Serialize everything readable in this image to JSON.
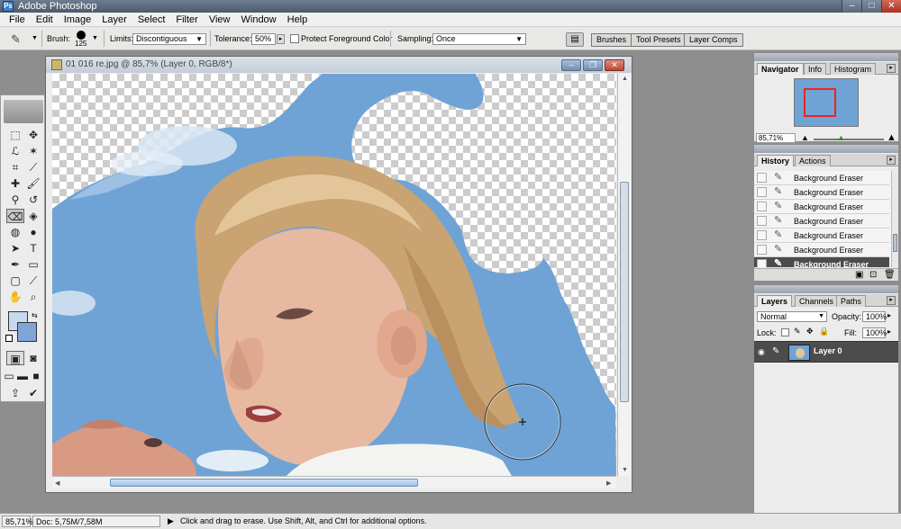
{
  "window": {
    "title": "Adobe Photoshop",
    "app_icon": "Ps"
  },
  "window_buttons": {
    "minimize": "–",
    "maximize": "□",
    "close": "✕"
  },
  "menu": [
    "File",
    "Edit",
    "Image",
    "Layer",
    "Select",
    "Filter",
    "View",
    "Window",
    "Help"
  ],
  "options": {
    "brush_label": "Brush:",
    "brush_size": "125",
    "limits_label": "Limits:",
    "limits_value": "Discontiguous",
    "tolerance_label": "Tolerance:",
    "tolerance_value": "50%",
    "protect_label": "Protect Foreground Color",
    "sampling_label": "Sampling:",
    "sampling_value": "Once",
    "tab_wells": [
      "Brushes",
      "Tool Presets",
      "Layer Comps"
    ]
  },
  "document": {
    "title": "01 016 re.jpg @ 85,7% (Layer 0, RGB/8*)",
    "buttons": {
      "minimize": "–",
      "restore": "❐",
      "close": "✕"
    }
  },
  "status": {
    "zoom": "85,71%",
    "doc": "Doc: 5,75M/7,58M",
    "hint": "Click and drag to erase.  Use Shift, Alt, and Ctrl for additional options."
  },
  "navigator": {
    "tabs": [
      "Navigator",
      "Info",
      "Histogram"
    ],
    "zoom": "85,71%"
  },
  "history": {
    "tabs": [
      "History",
      "Actions"
    ],
    "items": [
      "Background Eraser",
      "Background Eraser",
      "Background Eraser",
      "Background Eraser",
      "Background Eraser",
      "Background Eraser",
      "Background Eraser"
    ]
  },
  "layers": {
    "tabs": [
      "Layers",
      "Channels",
      "Paths"
    ],
    "blend_mode": "Normal",
    "opacity_label": "Opacity:",
    "opacity_value": "100%",
    "lock_label": "Lock:",
    "fill_label": "Fill:",
    "fill_value": "100%",
    "layer_name": "Layer 0"
  },
  "colors": {
    "foreground": "#c8d8ef",
    "background": "#7ea4d8",
    "sky": "#6fa3d5"
  }
}
